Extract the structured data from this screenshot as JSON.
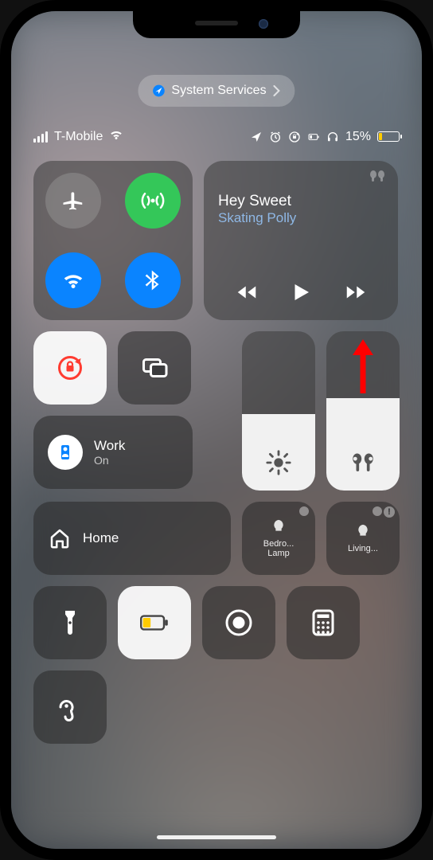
{
  "banner": {
    "label": "System Services"
  },
  "status": {
    "carrier": "T-Mobile",
    "battery_text": "15%",
    "battery_pct": 15
  },
  "connectivity": {
    "airplane": "Airplane Mode",
    "cellular": "Cellular Data",
    "wifi": "Wi-Fi",
    "bluetooth": "Bluetooth"
  },
  "media": {
    "title": "Hey Sweet",
    "artist": "Skating Polly",
    "output_icon": "airpods"
  },
  "focus": {
    "name": "Work",
    "state": "On"
  },
  "sliders": {
    "brightness_pct": 48,
    "volume_pct": 58
  },
  "home": {
    "label": "Home",
    "accessories": [
      {
        "name": "Bedro...\nLamp"
      },
      {
        "name": "Living..."
      }
    ]
  },
  "toggles": {
    "orientation_lock": true,
    "screen_mirroring": "Screen Mirroring",
    "flashlight": "Off",
    "low_power": "Low Power Mode",
    "screen_record": "Screen Recording",
    "calculator": "Calculator",
    "hearing": "Hearing"
  },
  "colors": {
    "accent_blue": "#0a84ff",
    "accent_green": "#34c759",
    "highlight": "#ff0000",
    "low_power_fill": "#ffcc00"
  }
}
